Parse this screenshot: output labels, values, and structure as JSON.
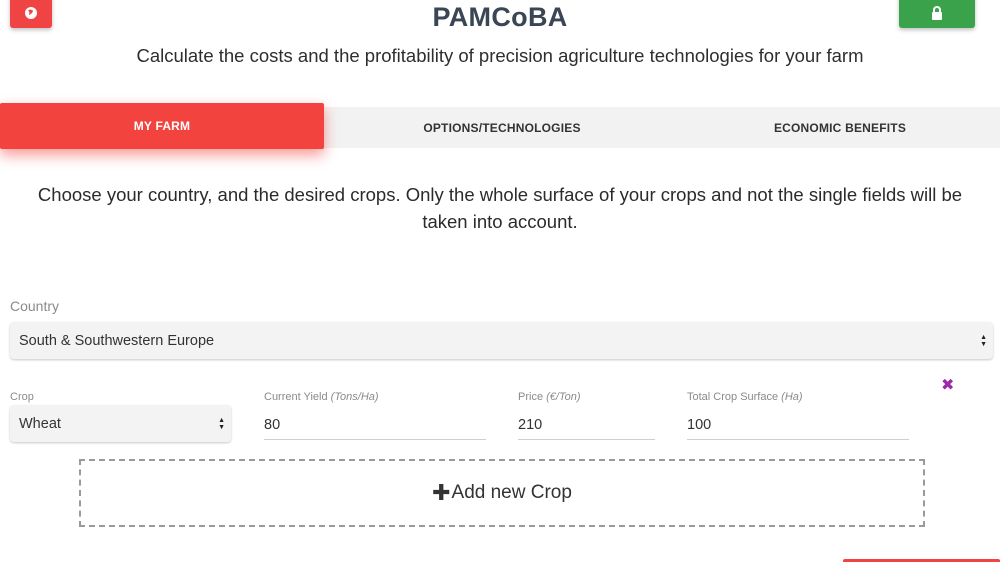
{
  "header": {
    "title": "PAMCoBA",
    "subtitle": "Calculate the costs and the profitability of precision agriculture technologies for your farm",
    "help_icon": "help-globe-icon",
    "lock_icon": "lock-icon"
  },
  "tabs": [
    {
      "label": "MY FARM",
      "active": true
    },
    {
      "label": "OPTIONS/TECHNOLOGIES",
      "active": false
    },
    {
      "label": "ECONOMIC BENEFITS",
      "active": false
    }
  ],
  "intro": "Choose your country, and the desired crops. Only the whole surface of your crops and not the single fields will be taken into account.",
  "country": {
    "label": "Country",
    "selected": "South & Southwestern Europe"
  },
  "crop_row": {
    "crop_label": "Crop",
    "crop_selected": "Wheat",
    "yield_label": "Current Yield",
    "yield_unit": "(Tons/Ha)",
    "yield_value": "80",
    "price_label": "Price",
    "price_unit": "(€/Ton)",
    "price_value": "210",
    "surface_label": "Total Crop Surface",
    "surface_unit": "(Ha)",
    "surface_value": "100",
    "remove_symbol": "✖"
  },
  "add_crop": {
    "plus": "✚",
    "label": "Add new Crop"
  },
  "colors": {
    "accent_red": "#f2433f",
    "lock_green": "#3aa24a",
    "remove_purple": "#9c2aa8",
    "title": "#3a4654"
  }
}
